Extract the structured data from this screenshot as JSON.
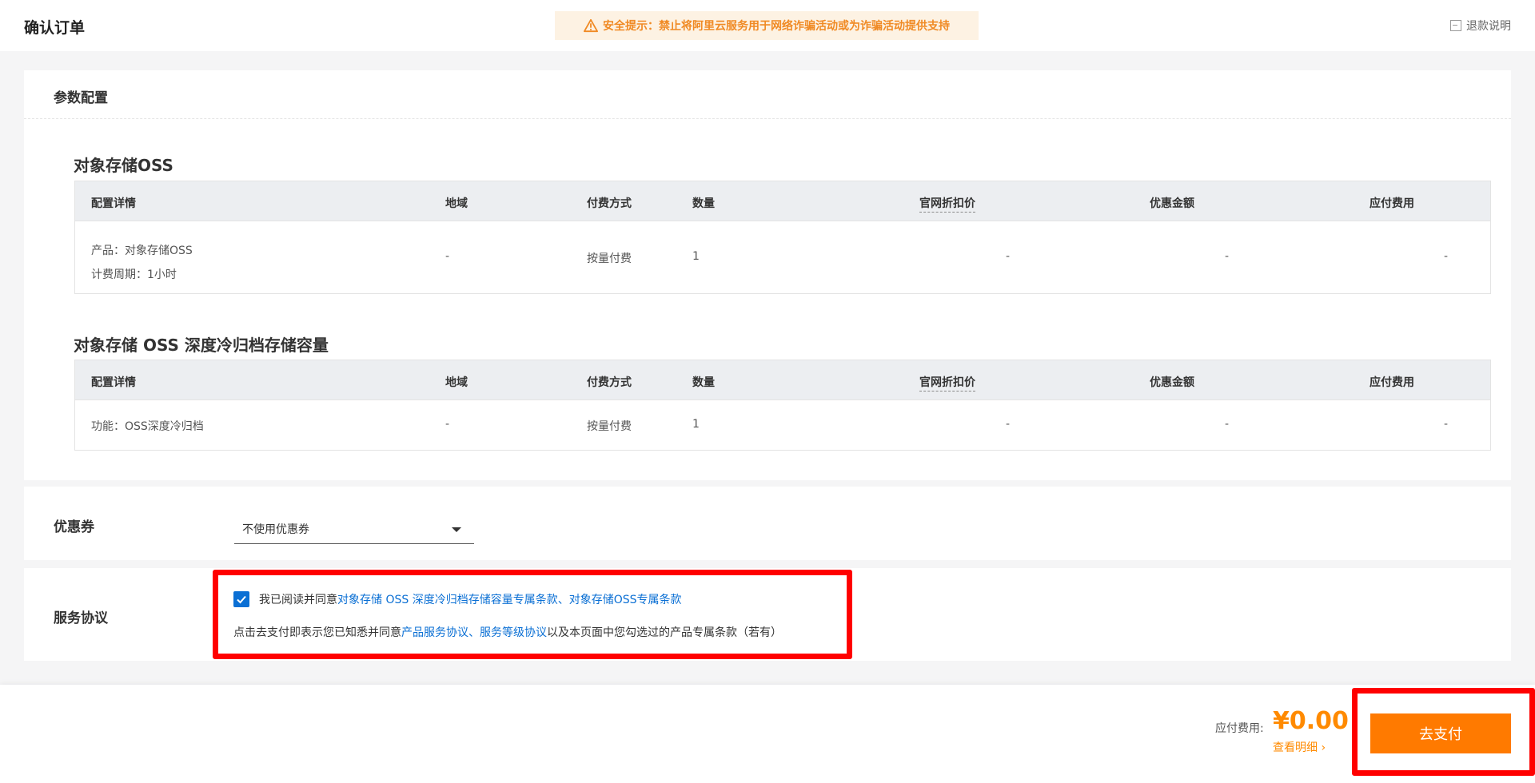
{
  "header": {
    "title": "确认订单",
    "warning": "安全提示：禁止将阿里云服务用于网络诈骗活动或为诈骗活动提供支持",
    "refund": "退款说明"
  },
  "params": {
    "title": "参数配置",
    "columns": [
      "配置详情",
      "地域",
      "付费方式",
      "数量",
      "官网折扣价",
      "优惠金额",
      "应付费用"
    ],
    "sections": [
      {
        "title": "对象存储OSS",
        "row": {
          "detail_lines": [
            "产品：对象存储OSS",
            "计费周期：1小时"
          ],
          "region": "-",
          "billing": "按量付费",
          "quantity": "1",
          "list_price": "-",
          "discount": "-",
          "payable": "-"
        }
      },
      {
        "title": "对象存储 OSS 深度冷归档存储容量",
        "row": {
          "detail_lines": [
            "功能：OSS深度冷归档"
          ],
          "region": "-",
          "billing": "按量付费",
          "quantity": "1",
          "list_price": "-",
          "discount": "-",
          "payable": "-"
        }
      }
    ]
  },
  "coupon": {
    "label": "优惠券",
    "selected": "不使用优惠券"
  },
  "agreement": {
    "label": "服务协议",
    "checked": true,
    "line1_prefix": "我已阅读并同意 ",
    "link_deep_archive": "对象存储 OSS 深度冷归档存储容量专属条款",
    "sep": "、",
    "link_oss": "对象存储OSS专属条款",
    "line2_prefix": "点击去支付即表示您已知悉并同意",
    "link_product": "产品服务协议",
    "sep2": "、",
    "link_sla": "服务等级协议",
    "line2_suffix": "以及本页面中您勾选过的产品专属条款（若有）"
  },
  "footer": {
    "due_label": "应付费用:",
    "amount": "¥0.00",
    "view_detail": "查看明细",
    "pay_button": "去支付"
  },
  "colors": {
    "accent_blue": "#0a6fd4",
    "orange": "#ff7a00",
    "highlight_red": "#ff0000"
  }
}
